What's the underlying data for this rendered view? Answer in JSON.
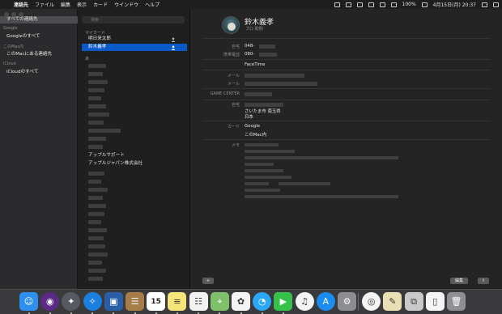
{
  "menubar": {
    "apple": "",
    "items": [
      "連絡先",
      "ファイル",
      "編集",
      "表示",
      "カード",
      "ウインドウ",
      "ヘルプ"
    ],
    "status": {
      "battery": "100%",
      "date_time": "4月15日(月) 20:37"
    }
  },
  "sidebar": {
    "all_contacts": "すべての連絡先",
    "google_header": "Google",
    "google_all": "Googleのすべて",
    "mac_header": "このMac内",
    "mac_contacts": "このMacにある連絡先",
    "icloud_header": "iCloud",
    "icloud_all": "iCloudのすべて"
  },
  "list": {
    "search_placeholder": "検索",
    "my_card_header": "マイカード",
    "my_card_rows": [
      "明日来太郎",
      "鈴木義孝"
    ],
    "section_a": "あ",
    "company_rows": [
      "アップルサポート",
      "アップルジャパン株式会社"
    ]
  },
  "detail": {
    "name": "鈴木義孝",
    "subtitle": "ブロ 助例",
    "fields": [
      {
        "label": "自宅",
        "value": "048-"
      },
      {
        "label": "携帯電話",
        "value": "080-"
      },
      {
        "label": "",
        "value": "FaceTime"
      },
      {
        "label": "メール",
        "value": ""
      },
      {
        "label": "メール",
        "value": ""
      },
      {
        "label": "GAME CENTER",
        "value": ""
      },
      {
        "label": "自宅",
        "value": "さいたま市 南玉県"
      },
      {
        "label": "",
        "value": "日本"
      },
      {
        "label": "カード",
        "value": "Google"
      },
      {
        "label": "",
        "value": "このMac内"
      },
      {
        "label": "メモ",
        "value": ""
      }
    ],
    "add_button": "+",
    "edit_button": "編集",
    "share_button": "⇪"
  },
  "dock": {
    "apps": [
      {
        "name": "finder",
        "color": "#2f8ff0",
        "glyph": "☺"
      },
      {
        "name": "siri",
        "color": "#5b2a86",
        "glyph": "◉"
      },
      {
        "name": "launchpad",
        "color": "#555a62",
        "glyph": "✦"
      },
      {
        "name": "safari",
        "color": "#1b7fe0",
        "glyph": "✧"
      },
      {
        "name": "photos-viewer",
        "color": "#2a5fa8",
        "glyph": "▣"
      },
      {
        "name": "contacts",
        "color": "#a67c47",
        "glyph": "☰"
      },
      {
        "name": "calendar",
        "color": "#ffffff",
        "glyph": "15"
      },
      {
        "name": "notes",
        "color": "#f6e37a",
        "glyph": "≡"
      },
      {
        "name": "reminders",
        "color": "#f2f2f2",
        "glyph": "☷"
      },
      {
        "name": "maps",
        "color": "#7fc16a",
        "glyph": "⌖"
      },
      {
        "name": "photos",
        "color": "#f4f4f4",
        "glyph": "✿"
      },
      {
        "name": "messages",
        "color": "#2ba7f7",
        "glyph": "◔"
      },
      {
        "name": "facetime",
        "color": "#35c24a",
        "glyph": "▶"
      },
      {
        "name": "music",
        "color": "#f4f4f4",
        "glyph": "♫"
      },
      {
        "name": "app-store",
        "color": "#1c8cf0",
        "glyph": "A"
      },
      {
        "name": "system-preferences",
        "color": "#8b8d91",
        "glyph": "⚙"
      },
      {
        "name": "chrome",
        "color": "#f4f4f4",
        "glyph": "◎"
      },
      {
        "name": "textedit",
        "color": "#e9dfb4",
        "glyph": "✎"
      },
      {
        "name": "preview",
        "color": "#c9c9c9",
        "glyph": "⧉"
      },
      {
        "name": "document",
        "color": "#f4f4f4",
        "glyph": "▯"
      },
      {
        "name": "trash",
        "color": "#8e9094",
        "glyph": "🗑"
      }
    ]
  }
}
